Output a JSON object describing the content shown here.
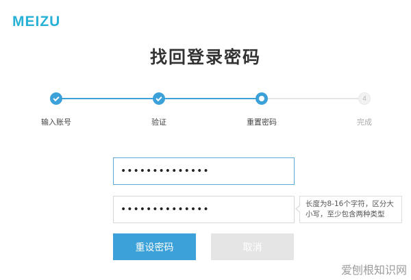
{
  "brand": {
    "logo_text": "MEIZU",
    "accent_color": "#3ca1d9"
  },
  "page": {
    "title": "找回登录密码"
  },
  "steps": [
    {
      "label": "输入账号",
      "state": "done",
      "icon": "check-icon"
    },
    {
      "label": "验证",
      "state": "done",
      "icon": "check-icon"
    },
    {
      "label": "重置密码",
      "state": "current",
      "icon": "current-dot-icon"
    },
    {
      "label": "完成",
      "state": "todo",
      "number": "4"
    }
  ],
  "form": {
    "new_password_value": "••••••••••••••",
    "confirm_password_value": "••••••••••••••",
    "hint_line1": "长度为8-16个字符，区分大",
    "hint_line2": "小写，至少包含两种类型",
    "submit_label": "重设密码",
    "cancel_label": "取消"
  },
  "watermark": {
    "text": "爱刨根知识网"
  }
}
